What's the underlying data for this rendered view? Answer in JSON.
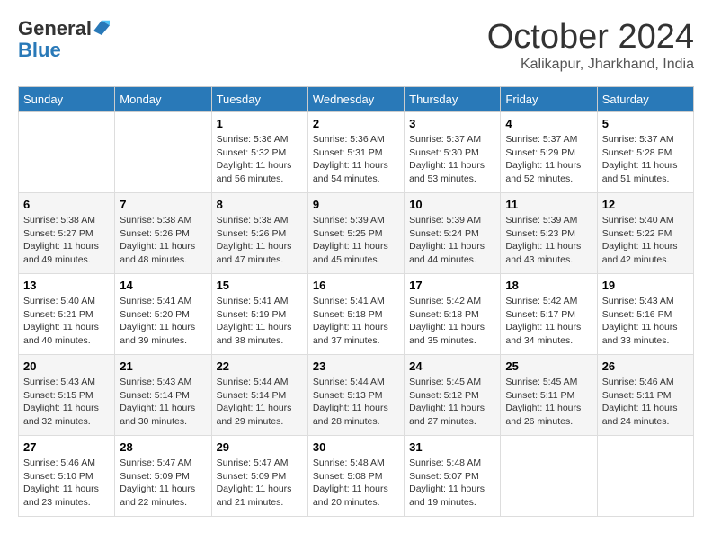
{
  "header": {
    "logo_line1": "General",
    "logo_line2": "Blue",
    "month_title": "October 2024",
    "subtitle": "Kalikapur, Jharkhand, India"
  },
  "weekdays": [
    "Sunday",
    "Monday",
    "Tuesday",
    "Wednesday",
    "Thursday",
    "Friday",
    "Saturday"
  ],
  "weeks": [
    [
      {
        "day": "",
        "info": ""
      },
      {
        "day": "",
        "info": ""
      },
      {
        "day": "1",
        "info": "Sunrise: 5:36 AM\nSunset: 5:32 PM\nDaylight: 11 hours and 56 minutes."
      },
      {
        "day": "2",
        "info": "Sunrise: 5:36 AM\nSunset: 5:31 PM\nDaylight: 11 hours and 54 minutes."
      },
      {
        "day": "3",
        "info": "Sunrise: 5:37 AM\nSunset: 5:30 PM\nDaylight: 11 hours and 53 minutes."
      },
      {
        "day": "4",
        "info": "Sunrise: 5:37 AM\nSunset: 5:29 PM\nDaylight: 11 hours and 52 minutes."
      },
      {
        "day": "5",
        "info": "Sunrise: 5:37 AM\nSunset: 5:28 PM\nDaylight: 11 hours and 51 minutes."
      }
    ],
    [
      {
        "day": "6",
        "info": "Sunrise: 5:38 AM\nSunset: 5:27 PM\nDaylight: 11 hours and 49 minutes."
      },
      {
        "day": "7",
        "info": "Sunrise: 5:38 AM\nSunset: 5:26 PM\nDaylight: 11 hours and 48 minutes."
      },
      {
        "day": "8",
        "info": "Sunrise: 5:38 AM\nSunset: 5:26 PM\nDaylight: 11 hours and 47 minutes."
      },
      {
        "day": "9",
        "info": "Sunrise: 5:39 AM\nSunset: 5:25 PM\nDaylight: 11 hours and 45 minutes."
      },
      {
        "day": "10",
        "info": "Sunrise: 5:39 AM\nSunset: 5:24 PM\nDaylight: 11 hours and 44 minutes."
      },
      {
        "day": "11",
        "info": "Sunrise: 5:39 AM\nSunset: 5:23 PM\nDaylight: 11 hours and 43 minutes."
      },
      {
        "day": "12",
        "info": "Sunrise: 5:40 AM\nSunset: 5:22 PM\nDaylight: 11 hours and 42 minutes."
      }
    ],
    [
      {
        "day": "13",
        "info": "Sunrise: 5:40 AM\nSunset: 5:21 PM\nDaylight: 11 hours and 40 minutes."
      },
      {
        "day": "14",
        "info": "Sunrise: 5:41 AM\nSunset: 5:20 PM\nDaylight: 11 hours and 39 minutes."
      },
      {
        "day": "15",
        "info": "Sunrise: 5:41 AM\nSunset: 5:19 PM\nDaylight: 11 hours and 38 minutes."
      },
      {
        "day": "16",
        "info": "Sunrise: 5:41 AM\nSunset: 5:18 PM\nDaylight: 11 hours and 37 minutes."
      },
      {
        "day": "17",
        "info": "Sunrise: 5:42 AM\nSunset: 5:18 PM\nDaylight: 11 hours and 35 minutes."
      },
      {
        "day": "18",
        "info": "Sunrise: 5:42 AM\nSunset: 5:17 PM\nDaylight: 11 hours and 34 minutes."
      },
      {
        "day": "19",
        "info": "Sunrise: 5:43 AM\nSunset: 5:16 PM\nDaylight: 11 hours and 33 minutes."
      }
    ],
    [
      {
        "day": "20",
        "info": "Sunrise: 5:43 AM\nSunset: 5:15 PM\nDaylight: 11 hours and 32 minutes."
      },
      {
        "day": "21",
        "info": "Sunrise: 5:43 AM\nSunset: 5:14 PM\nDaylight: 11 hours and 30 minutes."
      },
      {
        "day": "22",
        "info": "Sunrise: 5:44 AM\nSunset: 5:14 PM\nDaylight: 11 hours and 29 minutes."
      },
      {
        "day": "23",
        "info": "Sunrise: 5:44 AM\nSunset: 5:13 PM\nDaylight: 11 hours and 28 minutes."
      },
      {
        "day": "24",
        "info": "Sunrise: 5:45 AM\nSunset: 5:12 PM\nDaylight: 11 hours and 27 minutes."
      },
      {
        "day": "25",
        "info": "Sunrise: 5:45 AM\nSunset: 5:11 PM\nDaylight: 11 hours and 26 minutes."
      },
      {
        "day": "26",
        "info": "Sunrise: 5:46 AM\nSunset: 5:11 PM\nDaylight: 11 hours and 24 minutes."
      }
    ],
    [
      {
        "day": "27",
        "info": "Sunrise: 5:46 AM\nSunset: 5:10 PM\nDaylight: 11 hours and 23 minutes."
      },
      {
        "day": "28",
        "info": "Sunrise: 5:47 AM\nSunset: 5:09 PM\nDaylight: 11 hours and 22 minutes."
      },
      {
        "day": "29",
        "info": "Sunrise: 5:47 AM\nSunset: 5:09 PM\nDaylight: 11 hours and 21 minutes."
      },
      {
        "day": "30",
        "info": "Sunrise: 5:48 AM\nSunset: 5:08 PM\nDaylight: 11 hours and 20 minutes."
      },
      {
        "day": "31",
        "info": "Sunrise: 5:48 AM\nSunset: 5:07 PM\nDaylight: 11 hours and 19 minutes."
      },
      {
        "day": "",
        "info": ""
      },
      {
        "day": "",
        "info": ""
      }
    ]
  ]
}
